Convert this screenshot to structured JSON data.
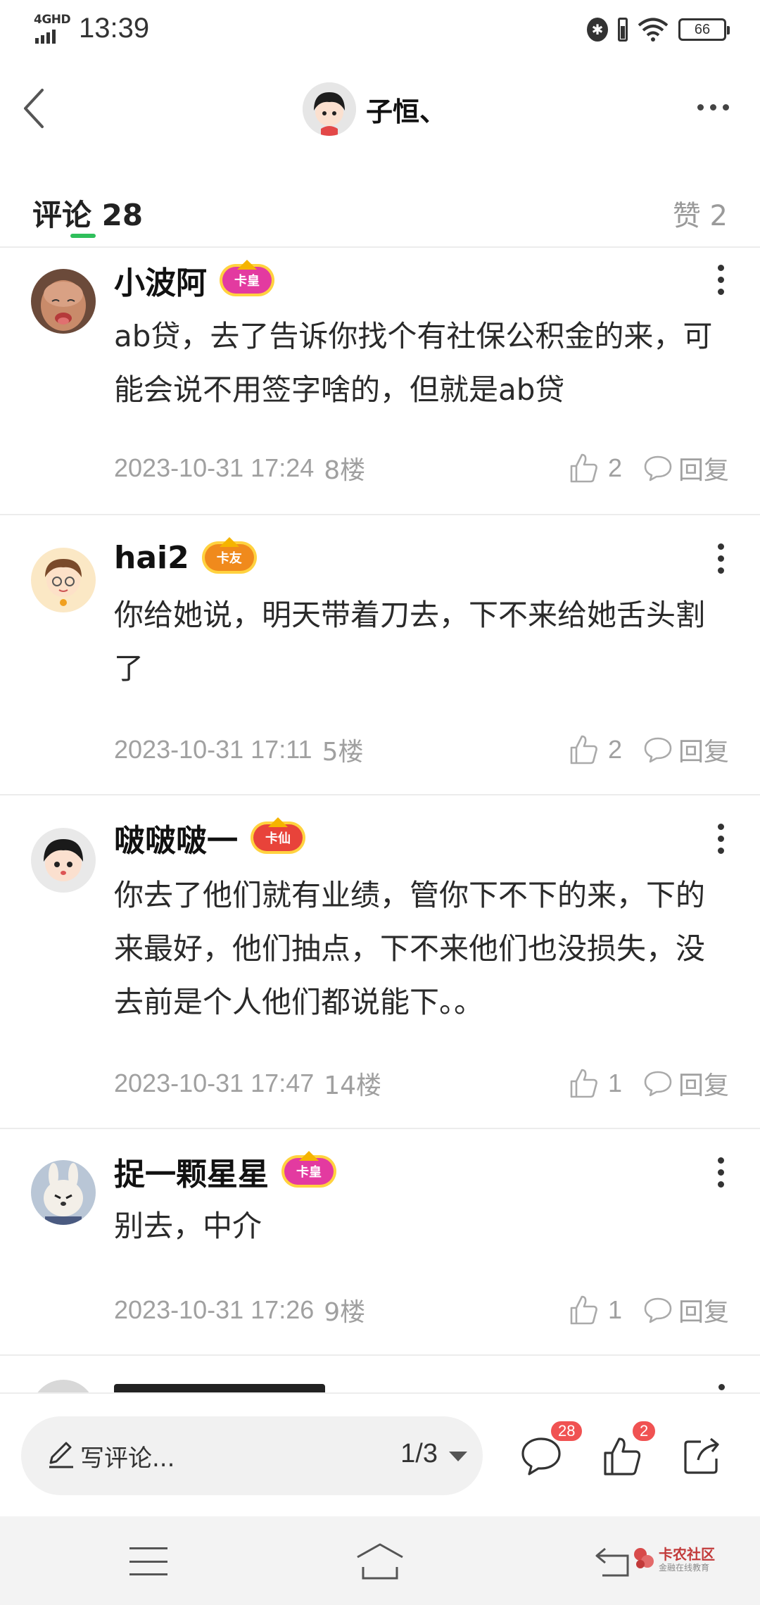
{
  "status_bar": {
    "network": "4GHD",
    "time": "13:39",
    "battery": "66"
  },
  "header": {
    "username": "子恒、"
  },
  "tabs": {
    "comments_label": "评论 28",
    "likes_label": "赞 2"
  },
  "comments": [
    {
      "name": "小波阿",
      "badge": "卡皇",
      "text": "ab贷，去了告诉你找个有社保公积金的来，可能会说不用签字啥的，但就是ab贷",
      "date": "2023-10-31 17:24",
      "floor": "8楼",
      "likes": "2",
      "reply": "回复"
    },
    {
      "name": "hai2",
      "badge": "卡友",
      "text": "你给她说，明天带着刀去，下不来给她舌头割了",
      "date": "2023-10-31 17:11",
      "floor": "5楼",
      "likes": "2",
      "reply": "回复"
    },
    {
      "name": "啵啵啵一",
      "badge": "卡仙",
      "text": "你去了他们就有业绩，管你下不下的来，下的来最好，他们抽点，下不来他们也没损失，没去前是个人他们都说能下。。",
      "date": "2023-10-31 17:47",
      "floor": "14楼",
      "likes": "1",
      "reply": "回复"
    },
    {
      "name": "捉一颗星星",
      "badge": "卡皇",
      "text": "别去，中介",
      "date": "2023-10-31 17:26",
      "floor": "9楼",
      "likes": "1",
      "reply": "回复"
    }
  ],
  "bottom_bar": {
    "write_placeholder": "写评论...",
    "page_indicator": "1/3",
    "comment_count": "28",
    "like_count": "2"
  },
  "watermark": {
    "title": "卡农社区",
    "subtitle": "金融在线教育"
  },
  "colors": {
    "accent_green": "#2fbf5b",
    "badge_red": "#f05252",
    "muted_text": "#a0a0a0"
  }
}
